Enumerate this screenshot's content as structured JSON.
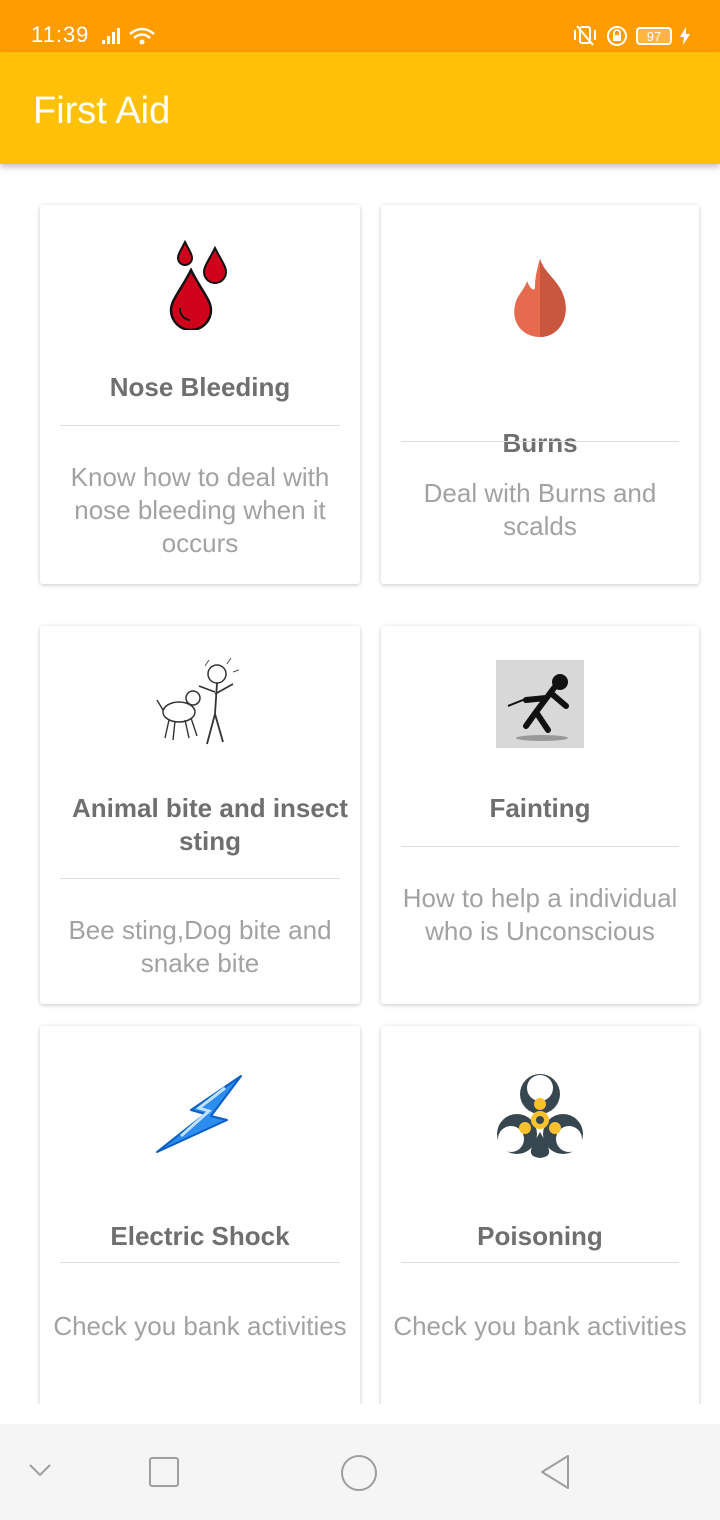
{
  "status_bar": {
    "time": "11:39",
    "battery": "97"
  },
  "app_bar": {
    "title": "First Aid"
  },
  "cards": [
    {
      "title": "Nose Bleeding",
      "description": "Know how to deal with nose bleeding when it occurs",
      "icon": "blood-drops-icon"
    },
    {
      "title": "Burns",
      "description": "Deal with Burns and scalds",
      "icon": "fire-icon"
    },
    {
      "title": "Animal bite and insect sting",
      "description": "Bee sting,Dog bite and snake bite",
      "icon": "dog-bite-image"
    },
    {
      "title": "Fainting",
      "description": "How to help  a individual who is Unconscious",
      "icon": "fainting-image"
    },
    {
      "title": "Electric Shock",
      "description": "Check you bank activities",
      "icon": "lightning-icon"
    },
    {
      "title": "Poisoning",
      "description": "Check you bank activities",
      "icon": "biohazard-icon"
    }
  ],
  "colors": {
    "status_bar": "#ff9d00",
    "app_bar": "#ffc107",
    "title_text": "#6f6f6f",
    "desc_text": "#a2a2a2"
  }
}
